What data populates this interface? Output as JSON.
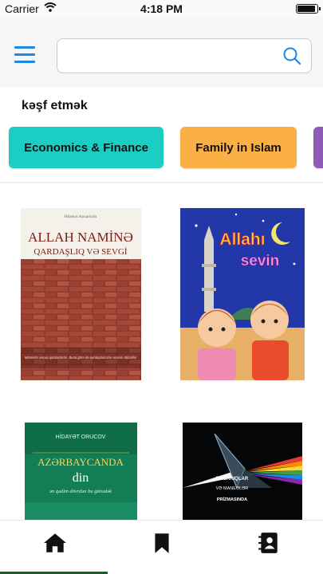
{
  "status_bar": {
    "carrier": "Carrier",
    "time": "4:18 PM"
  },
  "search": {
    "placeholder": "",
    "value": ""
  },
  "discover": {
    "title": "kəşf etmək",
    "categories": [
      {
        "label": "Economics & Finance",
        "color": "#1ccdc4"
      },
      {
        "label": "Family in Islam",
        "color": "#fbb045"
      },
      {
        "label": "",
        "color": "#8e5bb8"
      }
    ]
  },
  "books": [
    {
      "author": "Hüseyn Ansariyan",
      "title_line1": "ALLAH NAMİNƏ",
      "title_line2": "QARDAŞLIQ VƏ SEVGİ",
      "caption": "Möminlər ancaq qardaşdırlar. Buna görə də qardaşlarınızın arasını düzəldin"
    },
    {
      "title_line1": "Allahı",
      "title_line2": "sevin"
    },
    {
      "author": "HİDAYƏT ORUCOV",
      "title_line1": "AZƏRBAYCANDA",
      "title_line2": "din",
      "subtitle": "ən qədim dövrdən bu günədək"
    },
    {
      "title_line1": "BACARIQLAR",
      "title_line2": "VƏ MANEƏLƏR",
      "title_line3": "PRİZMASINDA"
    }
  ],
  "tabs": [
    {
      "icon": "home-icon"
    },
    {
      "icon": "bookmark-icon"
    },
    {
      "icon": "contacts-icon"
    }
  ],
  "colors": {
    "accent": "#1e88e5",
    "tab_indicator": "#1b5e20"
  }
}
